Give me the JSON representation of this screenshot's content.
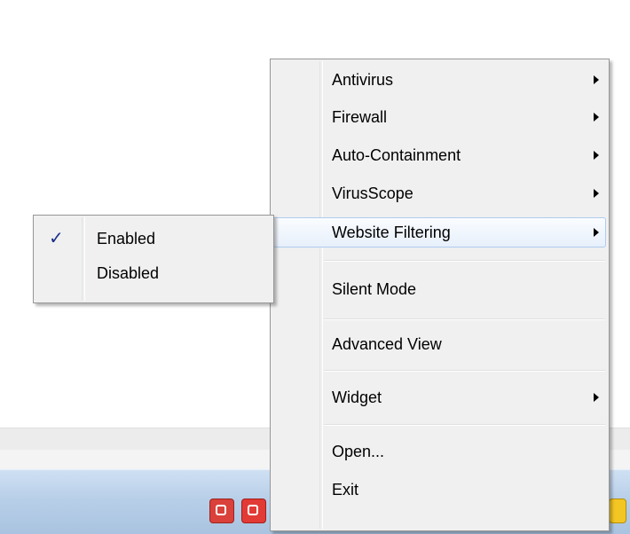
{
  "main_menu": {
    "items": [
      {
        "label": "Antivirus",
        "has_submenu": true
      },
      {
        "label": "Firewall",
        "has_submenu": true
      },
      {
        "label": "Auto-Containment",
        "has_submenu": true
      },
      {
        "label": "VirusScope",
        "has_submenu": true
      },
      {
        "label": "Website Filtering",
        "has_submenu": true,
        "highlighted": true
      },
      {
        "label": "Silent Mode",
        "has_submenu": false
      },
      {
        "label": "Advanced View",
        "has_submenu": false
      },
      {
        "label": "Widget",
        "has_submenu": true
      },
      {
        "label": "Open...",
        "has_submenu": false
      },
      {
        "label": "Exit",
        "has_submenu": false
      }
    ]
  },
  "submenu": {
    "parent": "Website Filtering",
    "items": [
      {
        "label": "Enabled",
        "checked": true,
        "check_glyph": "✓"
      },
      {
        "label": "Disabled",
        "checked": false
      }
    ]
  },
  "colors": {
    "menu_bg": "#f0f0f0",
    "highlight_border": "#aeccef",
    "check_color": "#1b2f8c",
    "taskbar": "#b8cfe8"
  },
  "icons": [
    "submenu-arrow-icon",
    "checkmark-icon",
    "tray-app-icon",
    "tray-warning-icon"
  ]
}
